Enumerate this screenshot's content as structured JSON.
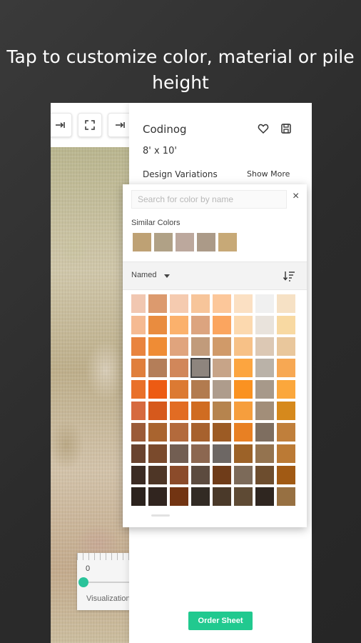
{
  "headline": {
    "line1": "Tap to customize color, material or pile",
    "line2": "height"
  },
  "toolbar": {
    "icons": [
      "expand-right-icon",
      "fullscreen-icon",
      "expand-right-icon"
    ]
  },
  "product": {
    "name": "Codinog",
    "size": "8' x 10'",
    "design_variations_label": "Design Variations",
    "show_more_label": "Show More",
    "order_button_label": "Order Sheet"
  },
  "visualization": {
    "zero_label": "0",
    "label": "Visualization"
  },
  "color_picker": {
    "search_placeholder": "Search for color by name",
    "close_label": "×",
    "similar_label": "Similar Colors",
    "similar_colors": [
      "#bea174",
      "#b0a186",
      "#bca89d",
      "#ab9a88",
      "#c7a977"
    ],
    "sort_label": "Named",
    "selected_index": 30,
    "swatches": [
      "#f1c7b1",
      "#dc9a6e",
      "#f5cbb0",
      "#f7c59a",
      "#fcc79a",
      "#fbe0c3",
      "#f0f0f0",
      "#f6e1c5",
      "#f6e8d6",
      "#f5ba92",
      "#e98c3f",
      "#fbb16c",
      "#dca47f",
      "#fba55f",
      "#fcd9af",
      "#e9e3dc",
      "#f8d9a2",
      "#f0e7de",
      "#e9843f",
      "#ef8c35",
      "#e0a47d",
      "#c19b7b",
      "#d09a69",
      "#f7c187",
      "#dcc8b4",
      "#e9c79c",
      "#d6ccc3",
      "#e07f3c",
      "#b47e59",
      "#d1875a",
      "#8e857e",
      "#c7a488",
      "#fca540",
      "#bab2a8",
      "#f7a853",
      "#c1b9af",
      "#e9712a",
      "#ed5b13",
      "#dc7a33",
      "#b27b4f",
      "#ae9c8c",
      "#fa9221",
      "#a7998a",
      "#fba73c",
      "#c39d6f",
      "#d66a3f",
      "#d6591c",
      "#e26c23",
      "#d06c21",
      "#b6844e",
      "#f69e3d",
      "#a28e79",
      "#d6891c",
      "#b59670",
      "#9b5b38",
      "#a9642f",
      "#b36a3c",
      "#a7612d",
      "#9c5b24",
      "#e88023",
      "#7e6e60",
      "#c07f3b",
      "#94755a",
      "#69432f",
      "#7a4a2c",
      "#725e52",
      "#8c6750",
      "#6d6764",
      "#9c6228",
      "#94734f",
      "#bb7a35",
      "#876b55",
      "#3b2b23",
      "#4e3626",
      "#8b4b2a",
      "#5c4b3f",
      "#6f3c19",
      "#7c6a59",
      "#6d4d2e",
      "#a15a14",
      "#6c584a",
      "#2b221d",
      "#31251f",
      "#723412",
      "#322b24",
      "#4a3929",
      "#5e4a34",
      "#2f2620",
      "#977042",
      "#4d3b2b"
    ]
  },
  "colors": {
    "accent": "#21c98f",
    "background": "#2b2b2b"
  }
}
